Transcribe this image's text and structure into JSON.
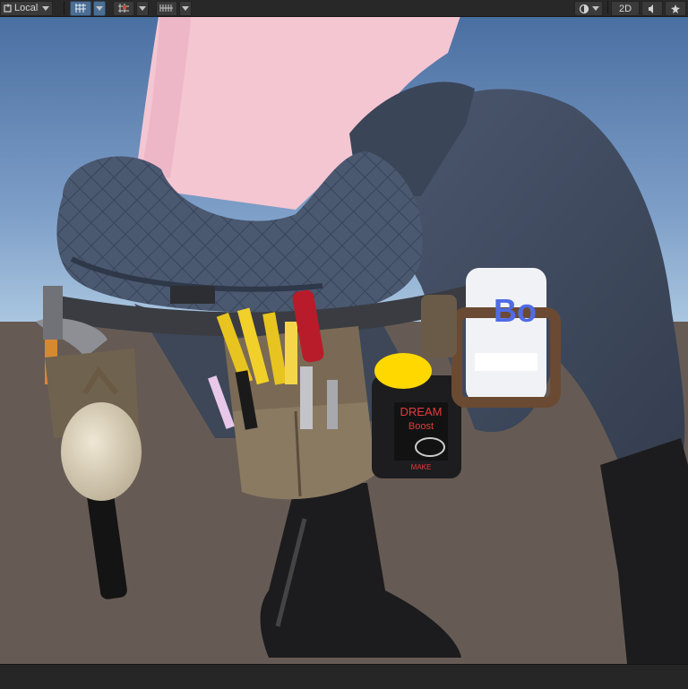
{
  "toolbar": {
    "pivot_mode_label": "Local",
    "mode_2d_label": "2D",
    "tools": [
      {
        "name": "local-handle-icon"
      },
      {
        "name": "grid-snap-icon"
      },
      {
        "name": "increment-snap-icon"
      },
      {
        "name": "ruler-grid-icon"
      }
    ],
    "right_tools": [
      {
        "name": "shading-mode-icon"
      },
      {
        "name": "2d-toggle"
      },
      {
        "name": "audio-toggle-icon"
      },
      {
        "name": "effects-icon"
      }
    ]
  },
  "scene": {
    "can_label": "Bo",
    "jar_label_line1": "DREAM",
    "jar_label_line2": "Boost",
    "jar_label_line3": "MAKE",
    "colors": {
      "sky_top": "#4a6fa1",
      "sky_bottom": "#a8c5e0",
      "ground": "#665b54",
      "skin": "#f4c6d2",
      "denim": "#3f4a5e",
      "belt": "#7a6a55",
      "boot": "#1c1c1e",
      "jar_lid": "#ffd800",
      "can_accent": "#4f6be6"
    }
  }
}
